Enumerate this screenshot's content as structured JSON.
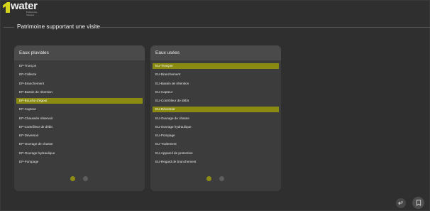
{
  "brand": {
    "name": "water",
    "tagline": "Patrimoine réseaux",
    "accent_color": "#d6d41c"
  },
  "section": {
    "title": "Patrimoine supportant une visite"
  },
  "cards": [
    {
      "title": "Eaux pluviales",
      "items": [
        "EP-Tronçon",
        "EP-Collecte",
        "EP-Branchement",
        "EP-Bassin de rétention",
        "EP-Bouche d'égout",
        "EP-Capteur",
        "EP-Chaussée réservoir",
        "EP-Contrôleur de débit",
        "EP-Déversoir",
        "EP-Ouvrage de chasse",
        "EP-Ouvrage hydraulique",
        "EP-Pompage"
      ],
      "selected_items": [
        "EP-Bouche d'égout"
      ],
      "page": 1,
      "pages": 2
    },
    {
      "title": "Eaux usées",
      "items": [
        "EU-Tronçon",
        "EU-Branchement",
        "EU-Bassin de rétention",
        "EU-Capteur",
        "EU-Contrôleur de débit",
        "EU-Déversoir",
        "EU-Ouvrage de chasse",
        "EU-Ouvrage hydraulique",
        "EU-Pompage",
        "EU-Traitement",
        "EU-Appareil de protection",
        "EU-Regard de branchement"
      ],
      "selected_items": [
        "EU-Tronçon",
        "EU-Déversoir"
      ],
      "page": 1,
      "pages": 2
    }
  ],
  "actions": {
    "back_icon": "undo-arrow-icon",
    "bookmark_icon": "bookmark-icon"
  },
  "colors": {
    "background": "#2f2f2f",
    "card": "#3c3c3c",
    "card_header": "#4a4a4a",
    "selected": "#8b8b12",
    "active_dot": "#8d8d16"
  }
}
